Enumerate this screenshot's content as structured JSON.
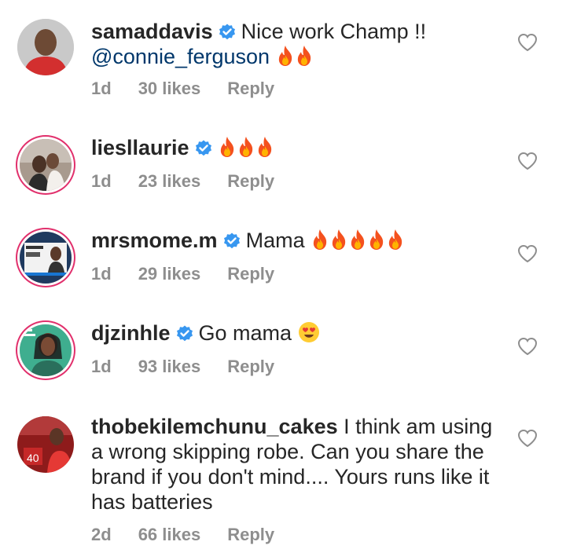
{
  "comments": [
    {
      "username": "samaddavis",
      "text": "Nice work Champ !!",
      "mention": "@connie_ferguson",
      "emoji": "fire",
      "emoji_count": 2,
      "age": "1d",
      "likes": "30 likes",
      "reply": "Reply"
    },
    {
      "username": "liesllaurie",
      "text": "",
      "emoji": "fire",
      "emoji_count": 3,
      "age": "1d",
      "likes": "23 likes",
      "reply": "Reply"
    },
    {
      "username": "mrsmome.m",
      "text": "Mama",
      "emoji": "fire",
      "emoji_count": 5,
      "age": "1d",
      "likes": "29 likes",
      "reply": "Reply"
    },
    {
      "username": "djzinhle",
      "text": "Go mama",
      "emoji": "heart-eyes",
      "emoji_count": 1,
      "age": "1d",
      "likes": "93 likes",
      "reply": "Reply"
    },
    {
      "username": "thobekilemchunu_cakes",
      "text": "I think am using a wrong skipping robe. Can you share the brand if you don't mind.... Yours runs like it has batteries",
      "age": "2d",
      "likes": "66 likes",
      "reply": "Reply"
    }
  ],
  "colors": {
    "verified": "#3897f0",
    "mention": "#00376b",
    "meta": "#8e8e8e",
    "fire": "#f4511e"
  }
}
